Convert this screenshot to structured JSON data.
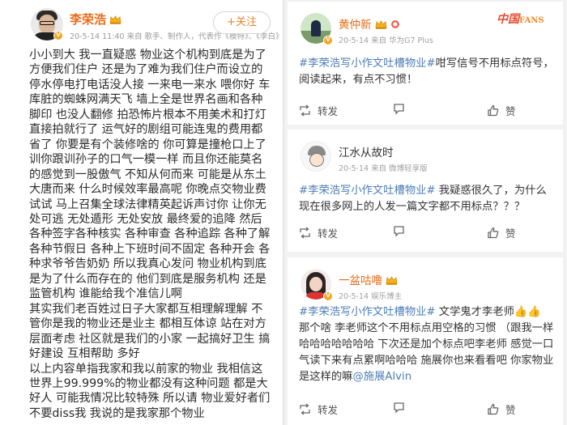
{
  "colors": {
    "name_orange": "#e86b17",
    "link_blue": "#4e7eb5",
    "meta_gray": "#9a9a9a",
    "panel_bg": "#f2f2f2"
  },
  "main_post": {
    "author": "李荣浩",
    "meta": "20-5-14 11:40 来自 歌手、制作人，代表作《模特》、《李白》等",
    "follow_label": "+关注",
    "body": "小小到大 我一直疑惑 物业这个机构到底是为了方便我们住户 还是为了难为我们住户而设立的 停水停电打电话没人接 一来电一来水 喂你好 车库脏的蜘蛛网满天飞 墙上全是世界名画和各种脚印 也没人翻修 拍恐怖片根本不用美术和打灯 直接拍就行了 运气好的剧组可能连鬼的费用都省了 你要是有个装修啥的 你可算是撞枪口上了 训你跟训孙子的口气一模一样 而且你还能莫名的感觉到一股傲气 不知从何而来 可能是从东土大唐而来 什么时候效率最高呢 你晚点交物业费试试 马上召集全球法律精英起诉声讨你 让你无处可逃 无处遁形 无处安放 最终爱的追降 然后各种签字各种核实 各种审查 各种追踪 各种了解 各种节假日 各种上下班时间不固定 各种开会 各种求爷爷告奶奶 所以我真心发问 物业机构到底是为了什么而存在的 他们到底是服务机构 还是监管机构 谁能给我个准信儿啊\n其实我们老百姓过日子大家都互相理解理解 不管你是我的物业还是业主 都相互体谅 站在对方层面考虑 社区就是我们的小家 一起搞好卫生 搞好建设 互相帮助 多好\n以上内容单指我家和我以前家的物业 我相信这世界上99.999%的物业都没有这种问题 都是大好人 可能我情况比较特殊 所以请 物业爱好者们 不要diss我 我说的是我家那个物业"
  },
  "logo": {
    "text": "中国",
    "suffix": "FANS"
  },
  "comments": [
    {
      "author": "黄仲新",
      "meta": "20-5-14 来自 华为G7 Plus",
      "topic": "#李荣浩写小作文吐槽物业#",
      "text": "咁写信号不用标点符号，阅读起来，有点不习惯！",
      "mention": "",
      "tail": "",
      "repost": "转发",
      "comment": "",
      "like": "赞"
    },
    {
      "author": "江水从故时",
      "meta": "20-5-14 来自 微博轻享版",
      "topic": "#李荣浩写小作文吐槽物业#",
      "text": " 我疑惑很久了，为什么现在很多网上的人发一篇文字都不用标点？？？",
      "mention": "",
      "tail": "",
      "repost": "转发",
      "comment": "",
      "like": "赞"
    },
    {
      "author": "一盆咕噜",
      "meta": "20-5-14 娱乐博主",
      "topic": "#李荣浩写小作文吐槽物业#",
      "text": " 文学鬼才李老师👍👍 那个啥 李老师这个不用标点用空格的习惯 （跟我一样哈哈哈哈哈哈哈 下次还是加个标点吧李老师 感觉一口气读下来有点累啊哈哈哈 施展你也来看看吧 你家物业是这样的嘛",
      "mention": "@施展Alvin",
      "tail": "",
      "repost": "转发",
      "comment": "",
      "like": "赞"
    }
  ]
}
